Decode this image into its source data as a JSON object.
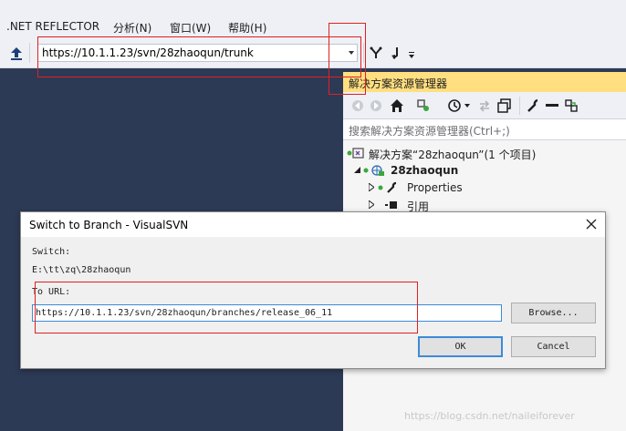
{
  "menu": {
    "items": [
      ".NET REFLECTOR",
      "分析(N)",
      "窗口(W)",
      "帮助(H)"
    ]
  },
  "toolbar": {
    "url": "https://10.1.1.23/svn/28zhaoqun/trunk"
  },
  "solution_explorer": {
    "title": "解决方案资源管理器",
    "search_placeholder": "搜索解决方案资源管理器(Ctrl+;)",
    "tree": [
      "解决方案“28zhaoqun”(1 个项目)",
      "28zhaoqun",
      "Properties",
      "引用"
    ]
  },
  "dialog": {
    "title": "Switch to Branch - VisualSVN",
    "switch_label": "Switch:",
    "switch_path": "E:\\tt\\zq\\28zhaoqun",
    "to_url_label": "To URL:",
    "to_url_value": "https://10.1.1.23/svn/28zhaoqun/branches/release_06_11",
    "browse_label": "Browse...",
    "ok_label": "OK",
    "cancel_label": "Cancel"
  },
  "watermark": "https://blog.csdn.net/naileiforever",
  "colors": {
    "highlight": "#e02020",
    "background": "#2d3a56",
    "se_title_bg": "#ffdf80"
  }
}
